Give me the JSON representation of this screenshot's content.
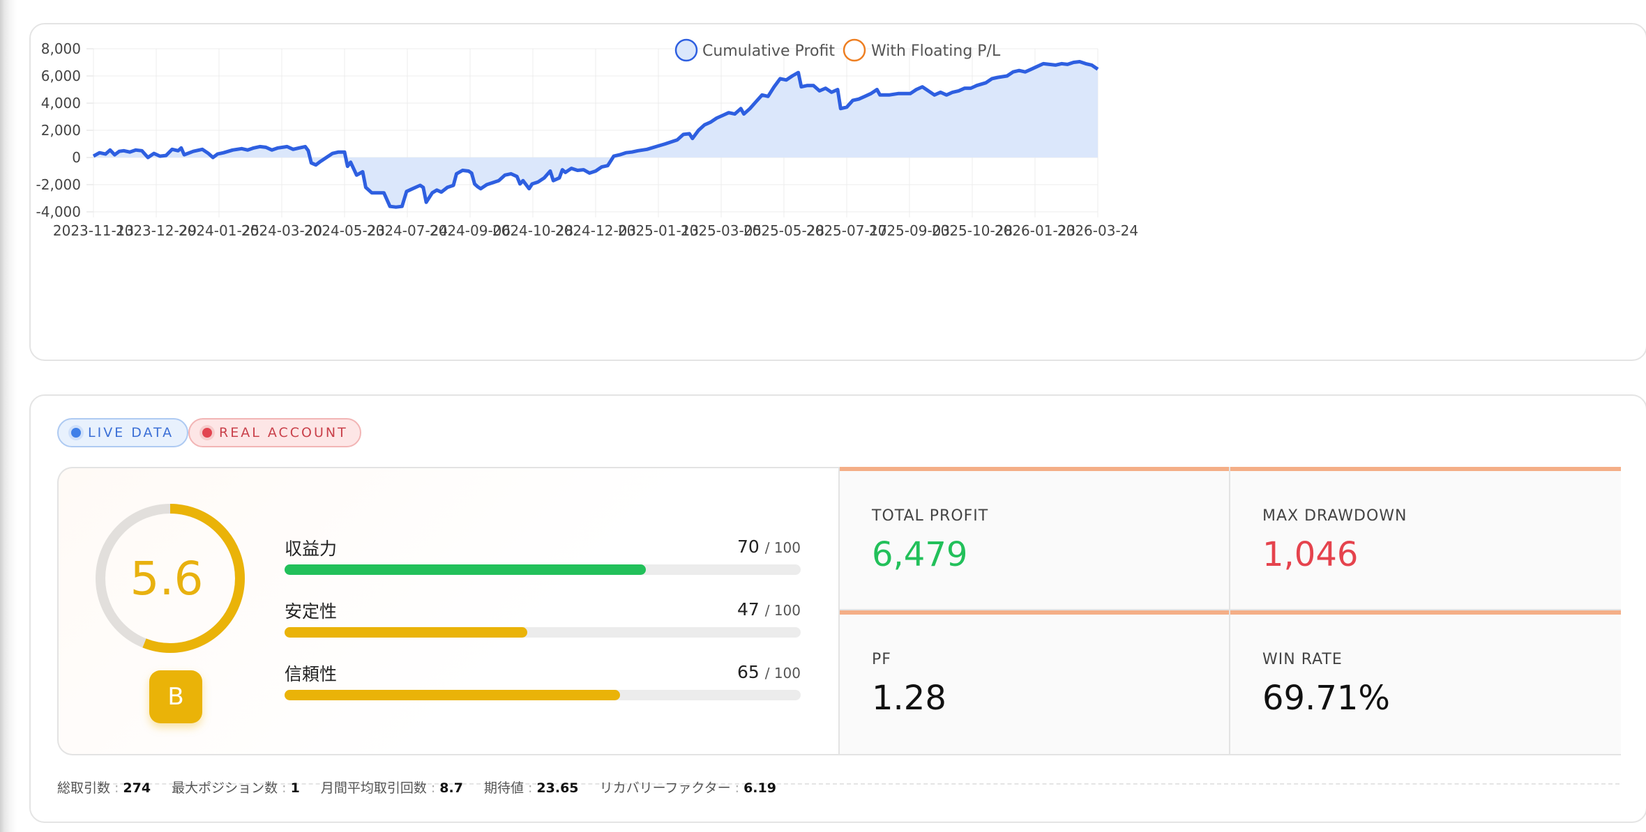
{
  "chart": {
    "legend": [
      {
        "label": "Cumulative Profit",
        "color": "#2e5fe0",
        "fill": "#dbe7fb"
      },
      {
        "label": "With Floating P/L",
        "color": "#ee7f22",
        "fill": "#ffffff"
      }
    ]
  },
  "chart_data": {
    "type": "area",
    "x_tick_labels": [
      "2023-11-13",
      "2023-12-29",
      "2024-01-25",
      "2024-03-20",
      "2024-05-23",
      "2024-07-24",
      "2024-09-06",
      "2024-10-28",
      "2024-12-03",
      "2025-01-13",
      "2025-03-05",
      "2025-05-28",
      "2025-07-17",
      "2025-09-03",
      "2025-10-28",
      "2026-01-23",
      "2026-03-24"
    ],
    "y_ticks": [
      8000,
      6000,
      4000,
      2000,
      0,
      -2000,
      -4000
    ],
    "y_tick_labels": [
      "8,000",
      "6,000",
      "4,000",
      "2,000",
      "0",
      "-2,000",
      "-4,000"
    ],
    "ylim": [
      -4000,
      8000
    ],
    "grid": true,
    "legend_position": "top-center",
    "series": [
      {
        "name": "Cumulative Profit",
        "color": "#2e5fe0",
        "points": [
          [
            0,
            100
          ],
          [
            0.2,
            350
          ],
          [
            0.4,
            250
          ],
          [
            0.55,
            550
          ],
          [
            0.7,
            200
          ],
          [
            0.85,
            450
          ],
          [
            1,
            500
          ],
          [
            1.2,
            400
          ],
          [
            1.4,
            550
          ],
          [
            1.6,
            500
          ],
          [
            1.8,
            0
          ],
          [
            2,
            300
          ],
          [
            2.2,
            100
          ],
          [
            2.4,
            150
          ],
          [
            2.6,
            600
          ],
          [
            2.8,
            500
          ],
          [
            2.9,
            700
          ],
          [
            3,
            200
          ],
          [
            3.3,
            450
          ],
          [
            3.6,
            600
          ],
          [
            3.8,
            300
          ],
          [
            3.95,
            0
          ],
          [
            4.1,
            250
          ],
          [
            4.3,
            350
          ],
          [
            4.6,
            550
          ],
          [
            4.9,
            650
          ],
          [
            5.1,
            550
          ],
          [
            5.3,
            700
          ],
          [
            5.5,
            800
          ],
          [
            5.7,
            750
          ],
          [
            5.9,
            550
          ],
          [
            6.1,
            700
          ],
          [
            6.4,
            800
          ],
          [
            6.6,
            600
          ],
          [
            6.8,
            700
          ],
          [
            7,
            800
          ],
          [
            7.1,
            500
          ],
          [
            7.2,
            -400
          ],
          [
            7.35,
            -550
          ],
          [
            7.5,
            -300
          ],
          [
            7.7,
            0
          ],
          [
            7.9,
            300
          ],
          [
            8.1,
            400
          ],
          [
            8.3,
            400
          ],
          [
            8.4,
            -650
          ],
          [
            8.5,
            -350
          ],
          [
            8.7,
            -1300
          ],
          [
            8.9,
            -1050
          ],
          [
            9,
            -2200
          ],
          [
            9.2,
            -2600
          ],
          [
            9.4,
            -2600
          ],
          [
            9.6,
            -2600
          ],
          [
            9.8,
            -3600
          ],
          [
            10,
            -3650
          ],
          [
            10.2,
            -3600
          ],
          [
            10.35,
            -2500
          ],
          [
            10.5,
            -2350
          ],
          [
            10.7,
            -2150
          ],
          [
            10.8,
            -2050
          ],
          [
            10.9,
            -2200
          ],
          [
            11,
            -3300
          ],
          [
            11.2,
            -2600
          ],
          [
            11.35,
            -2400
          ],
          [
            11.5,
            -2550
          ],
          [
            11.7,
            -2200
          ],
          [
            11.9,
            -2050
          ],
          [
            12,
            -1200
          ],
          [
            12.2,
            -950
          ],
          [
            12.4,
            -1000
          ],
          [
            12.5,
            -1150
          ],
          [
            12.6,
            -1950
          ],
          [
            12.7,
            -2150
          ],
          [
            12.8,
            -2300
          ],
          [
            13,
            -2000
          ],
          [
            13.2,
            -1850
          ],
          [
            13.4,
            -1700
          ],
          [
            13.6,
            -1300
          ],
          [
            13.8,
            -1200
          ],
          [
            14,
            -1400
          ],
          [
            14.1,
            -1950
          ],
          [
            14.2,
            -1700
          ],
          [
            14.4,
            -2300
          ],
          [
            14.5,
            -1950
          ],
          [
            14.7,
            -1800
          ],
          [
            14.9,
            -1500
          ],
          [
            15.1,
            -1000
          ],
          [
            15.2,
            -1700
          ],
          [
            15.4,
            -1500
          ],
          [
            15.5,
            -900
          ],
          [
            15.6,
            -1100
          ],
          [
            15.8,
            -800
          ],
          [
            16,
            -950
          ],
          [
            16.2,
            -900
          ],
          [
            16.4,
            -1150
          ],
          [
            16.6,
            -1000
          ],
          [
            16.8,
            -700
          ],
          [
            17,
            -600
          ],
          [
            17.2,
            100
          ],
          [
            17.4,
            200
          ],
          [
            17.6,
            350
          ],
          [
            17.8,
            400
          ],
          [
            18,
            500
          ],
          [
            18.3,
            600
          ],
          [
            18.6,
            800
          ],
          [
            18.9,
            1000
          ],
          [
            19.1,
            1150
          ],
          [
            19.3,
            1300
          ],
          [
            19.5,
            1700
          ],
          [
            19.7,
            1750
          ],
          [
            19.8,
            1400
          ],
          [
            20,
            2000
          ],
          [
            20.2,
            2400
          ],
          [
            20.4,
            2600
          ],
          [
            20.6,
            2900
          ],
          [
            20.8,
            3100
          ],
          [
            21,
            3300
          ],
          [
            21.2,
            3200
          ],
          [
            21.4,
            3600
          ],
          [
            21.5,
            3200
          ],
          [
            21.7,
            3600
          ],
          [
            21.9,
            4100
          ],
          [
            22.1,
            4600
          ],
          [
            22.3,
            4500
          ],
          [
            22.5,
            5200
          ],
          [
            22.7,
            5800
          ],
          [
            22.9,
            5700
          ],
          [
            23.1,
            6000
          ],
          [
            23.3,
            6250
          ],
          [
            23.4,
            5200
          ],
          [
            23.6,
            5300
          ],
          [
            23.8,
            5300
          ],
          [
            24,
            4900
          ],
          [
            24.2,
            5100
          ],
          [
            24.4,
            4800
          ],
          [
            24.6,
            5000
          ],
          [
            24.7,
            3600
          ],
          [
            24.9,
            3700
          ],
          [
            25.1,
            4200
          ],
          [
            25.3,
            4300
          ],
          [
            25.5,
            4500
          ],
          [
            25.7,
            4700
          ],
          [
            25.9,
            5000
          ],
          [
            26,
            4600
          ],
          [
            26.3,
            4600
          ],
          [
            26.6,
            4700
          ],
          [
            26.8,
            4700
          ],
          [
            27,
            4700
          ],
          [
            27.2,
            5000
          ],
          [
            27.4,
            5200
          ],
          [
            27.6,
            4900
          ],
          [
            27.8,
            4600
          ],
          [
            28,
            4800
          ],
          [
            28.2,
            4600
          ],
          [
            28.4,
            4800
          ],
          [
            28.6,
            4900
          ],
          [
            28.8,
            5100
          ],
          [
            29,
            5100
          ],
          [
            29.2,
            5300
          ],
          [
            29.5,
            5500
          ],
          [
            29.7,
            5800
          ],
          [
            29.9,
            5900
          ],
          [
            30.2,
            6000
          ],
          [
            30.4,
            6300
          ],
          [
            30.6,
            6400
          ],
          [
            30.8,
            6300
          ],
          [
            31,
            6500
          ],
          [
            31.2,
            6700
          ],
          [
            31.4,
            6900
          ],
          [
            31.6,
            6850
          ],
          [
            31.8,
            6800
          ],
          [
            32,
            6900
          ],
          [
            32.2,
            6850
          ],
          [
            32.4,
            7000
          ],
          [
            32.6,
            7050
          ],
          [
            32.8,
            6900
          ],
          [
            33,
            6800
          ],
          [
            33.2,
            6500
          ]
        ]
      }
    ]
  },
  "badges": {
    "live": "LIVE DATA",
    "real": "REAL ACCOUNT"
  },
  "score": {
    "value": "5.6",
    "gauge_fraction": 0.56,
    "gauge_color": "#eab308",
    "grade": "B",
    "metrics": [
      {
        "name": "収益力",
        "value": "70",
        "max": "/ 100",
        "fraction": 0.7,
        "color": "#22c05a"
      },
      {
        "name": "安定性",
        "value": "47",
        "max": "/ 100",
        "fraction": 0.47,
        "color": "#eab308"
      },
      {
        "name": "信頼性",
        "value": "65",
        "max": "/ 100",
        "fraction": 0.65,
        "color": "#eab308"
      }
    ]
  },
  "tiles": {
    "total_profit": {
      "label": "TOTAL PROFIT",
      "value": "6,479",
      "color": "#22c05a"
    },
    "max_drawdown": {
      "label": "MAX DRAWDOWN",
      "value": "1,046",
      "color": "#e5434d"
    },
    "pf": {
      "label": "PF",
      "value": "1.28",
      "color": "#111111"
    },
    "win_rate": {
      "label": "WIN RATE",
      "value": "69.71%",
      "color": "#111111"
    }
  },
  "summary": [
    {
      "label": "総取引数",
      "value": "274"
    },
    {
      "label": "最大ポジション数",
      "value": "1"
    },
    {
      "label": "月間平均取引回数",
      "value": "8.7"
    },
    {
      "label": "期待値",
      "value": "23.65"
    },
    {
      "label": "リカバリーファクター",
      "value": "6.19"
    }
  ]
}
